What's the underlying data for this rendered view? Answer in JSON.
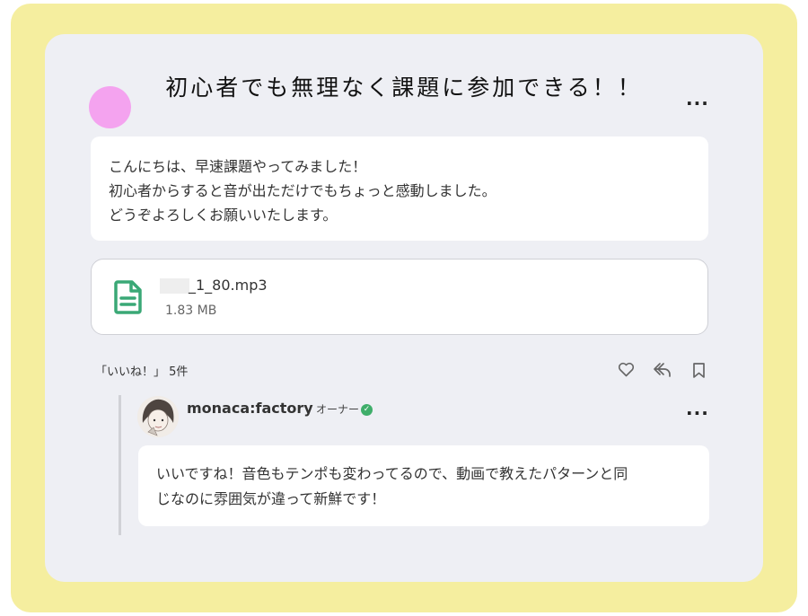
{
  "post": {
    "title": "初心者でも無理なく課題に参加できる！！",
    "more_icon": "···",
    "message_lines": [
      "こんにちは、早速課題やってみました！",
      "初心者からすると音が出ただけでもちょっと感動しました。",
      "どうぞよろしくお願いいたします。"
    ]
  },
  "attachment": {
    "filename": "_1_80.mp3",
    "size": "1.83 MB",
    "icon": "document-icon"
  },
  "reactions": {
    "likes_label": "「いいね！」 5件",
    "icons": [
      "heart-icon",
      "reply-icon",
      "bookmark-icon"
    ]
  },
  "reply": {
    "author": "monaca:factory",
    "role": "オーナー",
    "more_icon": "···",
    "lines": [
      "いいですね！音色もテンポも変わってるので、動画で教えたパターンと同",
      "じなのに雰囲気が違って新鮮です！"
    ]
  },
  "colors": {
    "frame": "#f5ee9f",
    "card": "#eeeff4",
    "avatar": "#f4a3ef",
    "file_icon": "#3aa876",
    "verified": "#3fae6a"
  }
}
